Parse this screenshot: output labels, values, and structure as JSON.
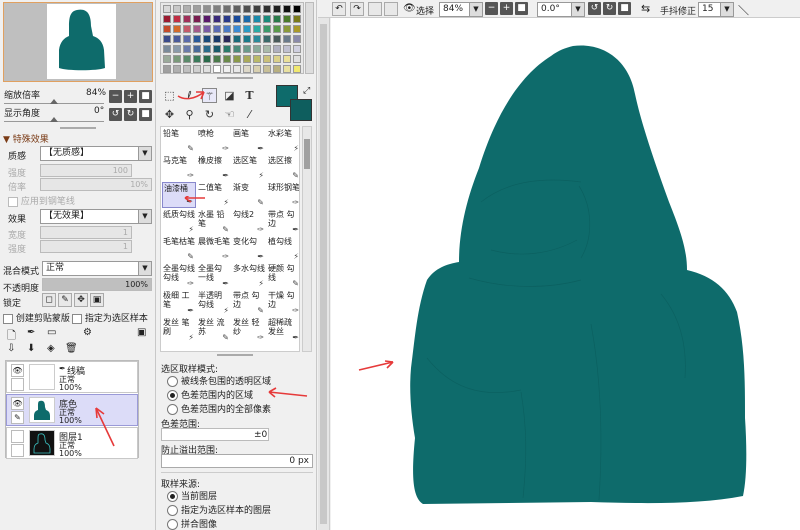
{
  "navigator": {
    "zoom_label": "缩放倍率",
    "zoom_value": "84%",
    "rotate_label": "显示角度",
    "rotate_value": "0°"
  },
  "effects": {
    "header": "特殊效果",
    "texture_label": "质感",
    "texture_value": "【无质感】",
    "strength_label": "强度",
    "strength_value": "100",
    "scale_label": "倍率",
    "scale_value": "10%",
    "apply_pen_label": "应用到钢笔线",
    "effect_label": "效果",
    "effect_value": "【无效果】",
    "width_label": "宽度",
    "width_value": "1",
    "strength2_label": "强度",
    "strength2_value": "1"
  },
  "blend": {
    "mode_label": "混合模式",
    "mode_value": "正常",
    "opacity_label": "不透明度",
    "opacity_value": "100%",
    "lock_label": "锁定",
    "clip_label": "创建剪贴蒙版",
    "sample_label": "指定为选区样本"
  },
  "layers": [
    {
      "name": "线稿",
      "mode": "正常",
      "opacity": "100%",
      "thumb": "empty",
      "selected": false
    },
    {
      "name": "底色",
      "mode": "正常",
      "opacity": "100%",
      "thumb": "teal",
      "selected": true
    },
    {
      "name": "图层1",
      "mode": "正常",
      "opacity": "100%",
      "thumb": "outline",
      "selected": false
    }
  ],
  "palette": {
    "current_color": "#0e6b6b"
  },
  "brushes": [
    [
      "铅笔",
      "喷枪",
      "画笔",
      "水彩笔"
    ],
    [
      "马克笔",
      "橡皮擦",
      "选区笔",
      "选区擦"
    ],
    [
      "油漆桶",
      "二值笔",
      "渐变",
      "球形钢笔"
    ],
    [
      "纸质勾线",
      "水墨 铅笔",
      "勾线2",
      "带点 勾边"
    ],
    [
      "毛笔枯笔",
      "晨微毛笔",
      "变化勾",
      "植勾线"
    ],
    [
      "全墨勾线 勾线",
      "全墨勾 一线",
      "多水勾线",
      "硬颜 勾线"
    ],
    [
      "极细 工笔",
      "半透明 勾线",
      "带点 勾边",
      "干燥 勾边"
    ],
    [
      "发丝 笔刷",
      "发丝 流苏",
      "发丝 轻纱",
      "超稀疏 发丝"
    ]
  ],
  "fill_options": {
    "mode_label": "选区取样模式:",
    "mode_opt1": "被线条包围的透明区域",
    "mode_opt2": "色差范围内的区域",
    "mode_opt3": "色差范围内的全部像素",
    "range_label": "色差范围:",
    "range_value": "±0",
    "overflow_label": "防止溢出范围:",
    "overflow_value": "0 px",
    "source_label": "取样来源:",
    "source_opt1": "当前图层",
    "source_opt2": "指定为选区样本的图层",
    "source_opt3": "拼合图像"
  },
  "toolbar": {
    "select_label": "选择",
    "zoom_value": "84%",
    "angle_value": "0.0°",
    "stabilizer_label": "手抖修正",
    "stabilizer_value": "15"
  },
  "tool_letters": {
    "text": "T"
  }
}
